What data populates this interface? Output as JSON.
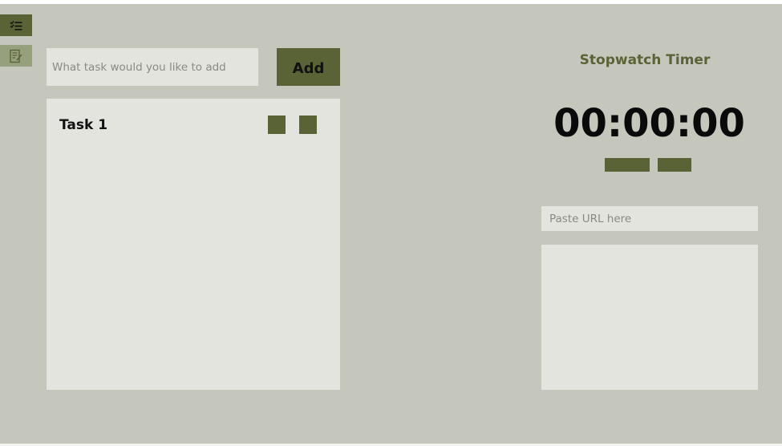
{
  "sidebar": {
    "items": [
      {
        "icon": "checklist-icon",
        "active": true
      },
      {
        "icon": "note-edit-icon",
        "active": false
      }
    ]
  },
  "todo": {
    "input": {
      "value": "",
      "placeholder": "What task would you like to add"
    },
    "add_label": "Add",
    "tasks": [
      {
        "label": "Task 1"
      }
    ]
  },
  "stopwatch": {
    "title": "Stopwatch Timer",
    "time": "00:00:00"
  },
  "embed": {
    "url_input": {
      "value": "",
      "placeholder": "Paste URL here"
    }
  },
  "colors": {
    "background": "#c5c6bc",
    "panel": "#e4e4de",
    "accent": "#5a6336",
    "accent_light": "#96a07c"
  }
}
